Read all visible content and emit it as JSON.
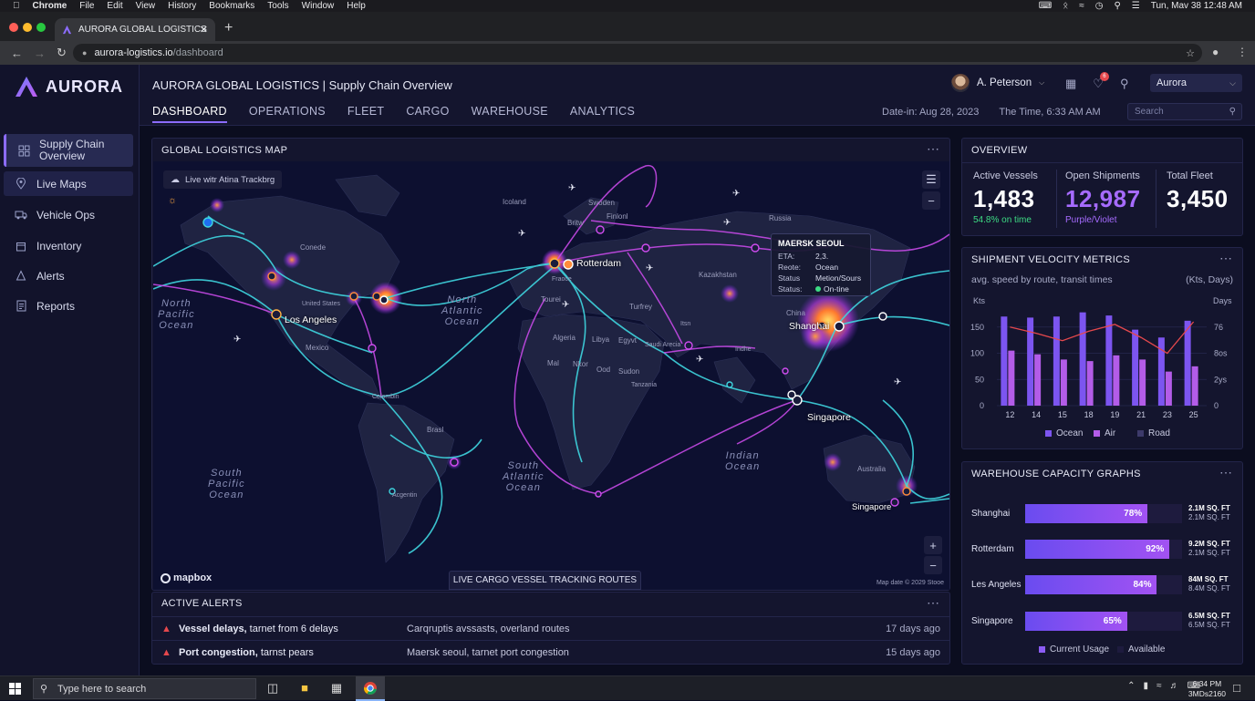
{
  "macbar": {
    "app": "Chrome",
    "menus": [
      "File",
      "Edit",
      "View",
      "History",
      "Bookmarks",
      "Tools",
      "Window",
      "Help"
    ],
    "clock": "Tun, Mav 38  12:48 AM"
  },
  "browser": {
    "tab_title": "AURORA GLOBAL LOGISTICS",
    "url_host": "aurora-logistics.io",
    "url_path": "/dashboard"
  },
  "sidebar": {
    "brand": "AURORA",
    "items": [
      {
        "label": "Supply Chain Overview",
        "icon": "grid-icon",
        "active": true
      },
      {
        "label": "Live Maps",
        "icon": "map-pin-icon",
        "active": false
      },
      {
        "label": "Vehicle Ops",
        "icon": "truck-icon",
        "active": false
      },
      {
        "label": "Inventory",
        "icon": "box-icon",
        "active": false
      },
      {
        "label": "Alerts",
        "icon": "bell-icon",
        "active": false
      },
      {
        "label": "Reports",
        "icon": "document-icon",
        "active": false
      }
    ]
  },
  "header": {
    "title": "AURORA GLOBAL LOGISTICS | Supply Chain Overview",
    "tabs": [
      "DASHBOARD",
      "OPERATIONS",
      "FLEET",
      "CARGO",
      "WAREHOUSE",
      "ANALYTICS"
    ],
    "user": "A. Peterson",
    "notification_count": "6",
    "account": "Aurora",
    "date": "Date-in: Aug 28, 2023",
    "time": "The Time, 6:33 AM AM",
    "search_placeholder": "Search"
  },
  "map": {
    "title": "GLOBAL LOGISTICS MAP",
    "live_label": "Live witr Atina Trackbrg",
    "oceans": {
      "north_pacific": "North\nPacific\nOcean",
      "north_atlantic": "North\nAtlantic\nOcean",
      "south_pacific": "South\nPacific\nOcean",
      "south_atlantic": "South\nAtlantic\nOcean",
      "indian": "Indian\nOcean"
    },
    "cities": {
      "rotterdam": "Rotterdam",
      "los_angeles": "Los Angeles",
      "shanghai": "Shanghai",
      "singapore": "Singapore",
      "singapore_au": "Singapore"
    },
    "labels": {
      "iceland": "Icoland",
      "sweden": "Swoden",
      "britw": "Britw",
      "finland": "Finlonl",
      "russia": "Russia",
      "canada": "Conede",
      "usa": "United States",
      "mexico": "Mexico",
      "france": "Fraoce",
      "tourei": "Tourei",
      "turkey": "Turfrey",
      "kazakhstan": "Kazakhstan",
      "china": "China",
      "algeria": "Algeria",
      "libya": "Libya",
      "egypt": "Egyvt",
      "saudi": "Saudi Arecia",
      "iran": "Itsn",
      "india": "Indhe",
      "mali": "Mal",
      "niger": "Nkor",
      "chad": "Ood",
      "sudan": "Sudon",
      "tanzania": "Tanzania",
      "colombia": "Celombin",
      "brazil": "Brasl",
      "argentina": "Acgentin",
      "australia": "Australia"
    },
    "tooltip": {
      "title": "MAERSK SEOUL",
      "eta_label": "ETA:",
      "eta": "2,3.",
      "route_label": "Reote:",
      "route": "Ocean",
      "status_label": "Status",
      "status": "Metion/Sours",
      "status2_label": "Status:",
      "status2": "On-tine"
    },
    "brand": "mapbox",
    "credit": "Map date © 2029 Stooe",
    "tracking_label": "LIVE CARGO VESSEL TRACKING ROUTES"
  },
  "alerts": {
    "title": "ACTIVE ALERTS",
    "rows": [
      {
        "title": "Vessel delays,",
        "detail": " tarnet from 6 delays",
        "desc": "Carqruptis avssasts, overland routes",
        "time": "17 days ago"
      },
      {
        "title": "Port congestion,",
        "detail": " tarnst pears",
        "desc": "Maersk seoul, tarnet port congestion",
        "time": "15 days ago"
      }
    ]
  },
  "overview": {
    "title": "OVERVIEW",
    "kpis": [
      {
        "label": "Active Vessels",
        "value": "1,483",
        "sub": "54.8% on time",
        "color": "#3ddc84"
      },
      {
        "label": "Open Shipments",
        "value": "12,987",
        "sub": "Purple/Violet",
        "color": "#a66bff"
      },
      {
        "label": "Total Fleet",
        "value": "3,450",
        "sub": "",
        "color": "#ffffff"
      }
    ]
  },
  "velocity": {
    "title": "SHIPMENT VELOCITY METRICS",
    "subtitle": "avg. speed by route, transit times",
    "units": "(Kts, Days)",
    "left_axis_label": "Kts",
    "right_axis_label": "Days"
  },
  "chart_data": {
    "type": "bar",
    "title": "SHIPMENT VELOCITY METRICS",
    "categories": [
      "12",
      "14",
      "15",
      "18",
      "19",
      "21",
      "23",
      "25"
    ],
    "series": [
      {
        "name": "Ocean",
        "values": [
          170,
          168,
          170,
          178,
          172,
          145,
          130,
          162
        ],
        "color": "#7c55f0"
      },
      {
        "name": "Air",
        "values": [
          105,
          98,
          88,
          85,
          96,
          88,
          65,
          75
        ],
        "color": "#b35ce8"
      },
      {
        "name": "Road",
        "values": [],
        "color": "#3d3a6a"
      }
    ],
    "line": {
      "values": [
        150,
        138,
        124,
        142,
        155,
        130,
        100,
        160
      ],
      "color": "#e5484d"
    },
    "ylim": [
      0,
      200
    ],
    "yticks_left": [
      "0",
      "50",
      "100",
      "150"
    ],
    "yticks_right": [
      "0",
      "2ys",
      "8os",
      "76"
    ],
    "legend_placement": "bottom"
  },
  "warehouse": {
    "title": "WAREHOUSE CAPACITY GRAPHS",
    "rows": [
      {
        "name": "Shanghai",
        "pct": 78,
        "pct_label": "78%",
        "v1": "2.1M SQ. FT",
        "v2": "2.1M SQ. FT"
      },
      {
        "name": "Rotterdam",
        "pct": 92,
        "pct_label": "92%",
        "v1": "9.2M SQ. FT",
        "v2": "2.1M SQ. FT"
      },
      {
        "name": "Les Angeles",
        "pct": 84,
        "pct_label": "84%",
        "v1": "84M SQ. FT",
        "v2": "8.4M SQ. FT"
      },
      {
        "name": "Singapore",
        "pct": 65,
        "pct_label": "65%",
        "v1": "6.5M SQ. FT",
        "v2": "6.5M SQ. FT"
      }
    ],
    "legend": [
      "Current Usage",
      "Available"
    ]
  },
  "taskbar": {
    "search_placeholder": "Type here to search",
    "time": "6:34 PM",
    "date": "3MDs2160"
  }
}
